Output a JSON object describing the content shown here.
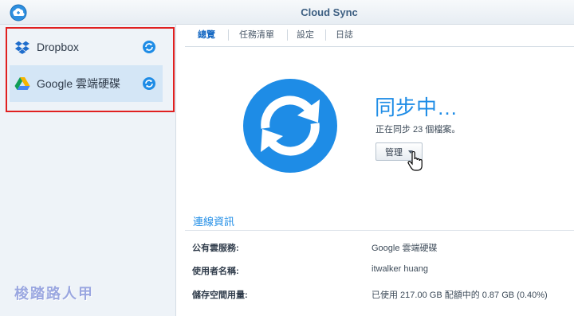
{
  "window": {
    "title": "Cloud Sync",
    "app_icon": "cloud-sync-icon"
  },
  "sidebar": {
    "items": [
      {
        "label": "Dropbox",
        "icon": "dropbox-icon",
        "status_icon": "sync-status-icon",
        "active": false
      },
      {
        "label": "Google 雲端硬碟",
        "icon": "google-drive-icon",
        "status_icon": "sync-status-icon",
        "active": true
      }
    ]
  },
  "tabs": [
    {
      "label": "總覽",
      "active": true
    },
    {
      "label": "任務清單",
      "active": false
    },
    {
      "label": "設定",
      "active": false
    },
    {
      "label": "日誌",
      "active": false
    }
  ],
  "status": {
    "title": "同步中…",
    "subtitle": "正在同步 23 個檔案。",
    "manage_label": "管理",
    "icon": "sync-arrows-icon"
  },
  "connection": {
    "title": "連線資訊",
    "rows": [
      {
        "label": "公有雲服務:",
        "value": "Google 雲端硬碟"
      },
      {
        "label": "使用者名稱:",
        "value": "itwalker huang"
      },
      {
        "label": "儲存空間用量:",
        "value": "已使用 217.00 GB 配額中的 0.87 GB (0.40%)"
      }
    ]
  },
  "watermark": "梭踏路人甲",
  "colors": {
    "accent": "#1e8ce6",
    "sidebar_bg": "#eef3f8",
    "active_item": "#d4e6f6",
    "highlight_box": "#e02020"
  }
}
